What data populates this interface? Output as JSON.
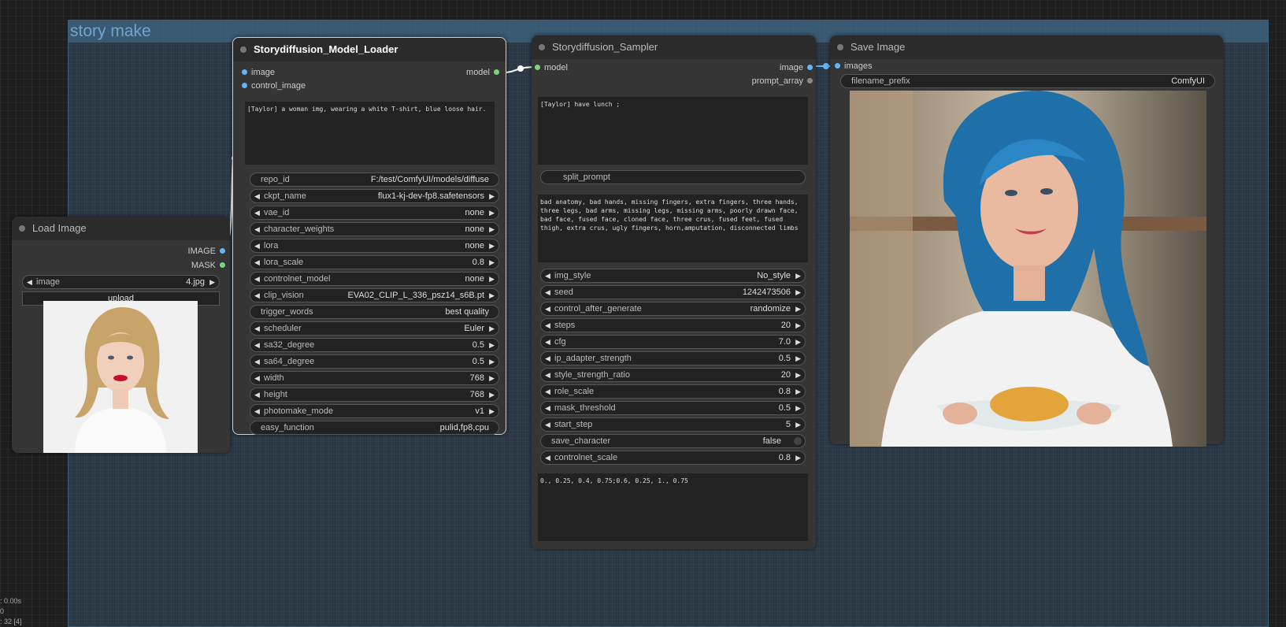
{
  "group": {
    "title": "story make"
  },
  "load_image": {
    "title": "Load Image",
    "outputs": [
      "IMAGE",
      "MASK"
    ],
    "image_widget": {
      "label": "image",
      "value": "4.jpg"
    },
    "upload_label": "upload",
    "preview": "portrait-woman-blonde"
  },
  "model_loader": {
    "title": "Storydiffusion_Model_Loader",
    "inputs": [
      "image",
      "control_image"
    ],
    "output": "model",
    "prompt": "[Taylor] a woman img, wearing a white T-shirt, blue loose hair.",
    "widgets": [
      {
        "label": "repo_id",
        "value": "F:/test/ComfyUI/models/diffuse",
        "arrows": false
      },
      {
        "label": "ckpt_name",
        "value": "flux1-kj-dev-fp8.safetensors",
        "arrows": true
      },
      {
        "label": "vae_id",
        "value": "none",
        "arrows": true
      },
      {
        "label": "character_weights",
        "value": "none",
        "arrows": true
      },
      {
        "label": "lora",
        "value": "none",
        "arrows": true
      },
      {
        "label": "lora_scale",
        "value": "0.8",
        "arrows": true
      },
      {
        "label": "controlnet_model",
        "value": "none",
        "arrows": true
      },
      {
        "label": "clip_vision",
        "value": "EVA02_CLIP_L_336_psz14_s6B.pt",
        "arrows": true
      },
      {
        "label": "trigger_words",
        "value": "best quality",
        "arrows": false
      },
      {
        "label": "scheduler",
        "value": "Euler",
        "arrows": true
      },
      {
        "label": "sa32_degree",
        "value": "0.5",
        "arrows": true
      },
      {
        "label": "sa64_degree",
        "value": "0.5",
        "arrows": true
      },
      {
        "label": "width",
        "value": "768",
        "arrows": true
      },
      {
        "label": "height",
        "value": "768",
        "arrows": true
      },
      {
        "label": "photomake_mode",
        "value": "v1",
        "arrows": true
      },
      {
        "label": "easy_function",
        "value": "pulid,fp8,cpu",
        "arrows": false
      }
    ]
  },
  "sampler": {
    "title": "Storydiffusion_Sampler",
    "input": "model",
    "outputs": [
      "image",
      "prompt_array"
    ],
    "prompt": "[Taylor] have lunch ;",
    "split_prompt": "split_prompt",
    "negative_prompt": "bad anatomy, bad hands, missing fingers, extra fingers, three hands, three legs, bad arms, missing legs, missing arms, poorly drawn face, bad face, fused face, cloned face, three crus, fused feet, fused thigh, extra crus, ugly fingers, horn,amputation, disconnected limbs",
    "widgets": [
      {
        "label": "img_style",
        "value": "No_style",
        "type": "arrows"
      },
      {
        "label": "seed",
        "value": "1242473506",
        "type": "arrows"
      },
      {
        "label": "control_after_generate",
        "value": "randomize",
        "type": "arrows"
      },
      {
        "label": "steps",
        "value": "20",
        "type": "arrows"
      },
      {
        "label": "cfg",
        "value": "7.0",
        "type": "arrows"
      },
      {
        "label": "ip_adapter_strength",
        "value": "0.5",
        "type": "arrows"
      },
      {
        "label": "style_strength_ratio",
        "value": "20",
        "type": "arrows"
      },
      {
        "label": "role_scale",
        "value": "0.8",
        "type": "arrows"
      },
      {
        "label": "mask_threshold",
        "value": "0.5",
        "type": "arrows"
      },
      {
        "label": "start_step",
        "value": "5",
        "type": "arrows"
      },
      {
        "label": "save_character",
        "value": "false",
        "type": "toggle"
      },
      {
        "label": "controlnet_scale",
        "value": "0.8",
        "type": "arrows"
      }
    ],
    "guidance_list": "0., 0.25, 0.4, 0.75;0.6, 0.25, 1., 0.75"
  },
  "save_image": {
    "title": "Save Image",
    "input": "images",
    "filename_prefix": {
      "label": "filename_prefix",
      "value": "ComfyUI"
    },
    "preview": "woman-blue-hair-holding-plate"
  },
  "stats": [
    ": 0.00s",
    "0",
    ": 32 [4]"
  ],
  "colors": {
    "image_slot": "#64b5f6",
    "model_slot": "#7bd47b",
    "group_bg": "#3c5f7d"
  }
}
